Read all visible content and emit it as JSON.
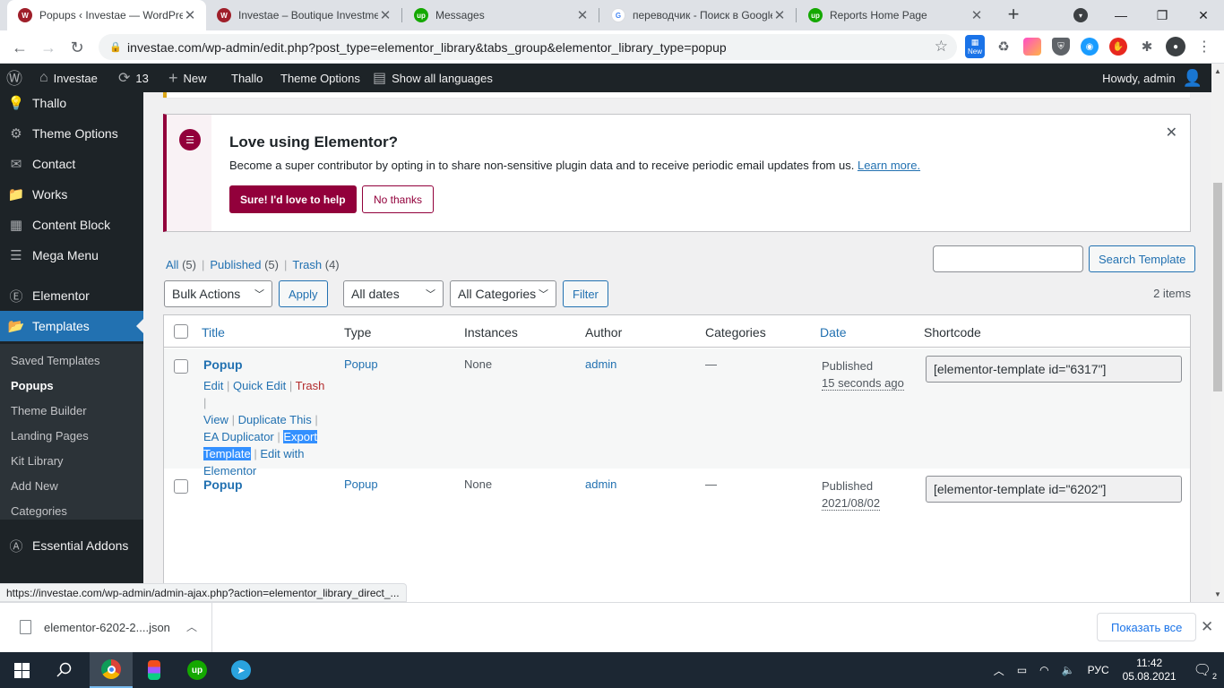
{
  "browser": {
    "tabs": [
      {
        "title": "Popups ‹ Investae — WordPress",
        "favicon": "wordpress-icon",
        "color": "#9f1f2a",
        "active": true
      },
      {
        "title": "Investae – Boutique Investment",
        "favicon": "wordpress-icon",
        "color": "#9f1f2a",
        "active": false
      },
      {
        "title": "Messages",
        "favicon": "upwork-icon",
        "color": "#14a800",
        "active": false
      },
      {
        "title": "переводчик - Поиск в Google",
        "favicon": "google-icon",
        "color": "#4285f4",
        "active": false
      },
      {
        "title": "Reports Home Page",
        "favicon": "upwork-icon",
        "color": "#14a800",
        "active": false
      }
    ],
    "url": "investae.com/wp-admin/edit.php?post_type=elementor_library&tabs_group&elementor_library_type=popup",
    "status_url": "https://investae.com/wp-admin/admin-ajax.php?action=elementor_library_direct_...",
    "ext_new_badge": "New"
  },
  "adminbar": {
    "site": "Investae",
    "updates": "13",
    "new": "New",
    "thallo": "Thallo",
    "theme_options": "Theme Options",
    "languages": "Show all languages",
    "howdy": "Howdy, admin"
  },
  "menu": {
    "thallo": "Thallo",
    "theme_options": "Theme Options",
    "contact": "Contact",
    "works": "Works",
    "content_block": "Content Block",
    "mega_menu": "Mega Menu",
    "elementor": "Elementor",
    "templates": "Templates",
    "sub": {
      "saved": "Saved Templates",
      "popups": "Popups",
      "theme_builder": "Theme Builder",
      "landing": "Landing Pages",
      "kit": "Kit Library",
      "add_new": "Add New",
      "categories": "Categories"
    },
    "essential": "Essential Addons"
  },
  "notice": {
    "title": "Love using Elementor?",
    "text": "Become a super contributor by opting in to share non-sensitive plugin data and to receive periodic email updates from us.",
    "learn_more": "Learn more.",
    "yes": "Sure! I'd love to help",
    "no": "No thanks"
  },
  "views": {
    "all": "All",
    "all_count": "(5)",
    "published": "Published",
    "published_count": "(5)",
    "trash": "Trash",
    "trash_count": "(4)"
  },
  "search": {
    "button": "Search Template"
  },
  "filters": {
    "bulk": "Bulk Actions",
    "apply": "Apply",
    "dates": "All dates",
    "categories": "All Categories",
    "filter": "Filter",
    "items": "2 items"
  },
  "table": {
    "headers": {
      "title": "Title",
      "type": "Type",
      "instances": "Instances",
      "author": "Author",
      "categories": "Categories",
      "date": "Date",
      "shortcode": "Shortcode"
    },
    "rows": [
      {
        "title": "Popup",
        "type": "Popup",
        "instances": "None",
        "author": "admin",
        "categories": "—",
        "status": "Published",
        "date": "15 seconds ago",
        "shortcode": "[elementor-template id=\"6317\"]",
        "actions": {
          "edit": "Edit",
          "quick_edit": "Quick Edit",
          "trash": "Trash",
          "view": "View",
          "duplicate": "Duplicate This",
          "ea_dup": "EA Duplicator",
          "export_1": "Export",
          "export_2": "Template",
          "edit_with": "Edit with",
          "elementor": "Elementor"
        }
      },
      {
        "title": "Popup",
        "type": "Popup",
        "instances": "None",
        "author": "admin",
        "categories": "—",
        "status": "Published",
        "date": "2021/08/02",
        "shortcode": "[elementor-template id=\"6202\"]"
      }
    ]
  },
  "downloads": {
    "file": "elementor-6202-2....json",
    "show_all": "Показать все"
  },
  "taskbar": {
    "lang": "РУС",
    "time": "11:42",
    "date": "05.08.2021",
    "notifications": "2"
  }
}
